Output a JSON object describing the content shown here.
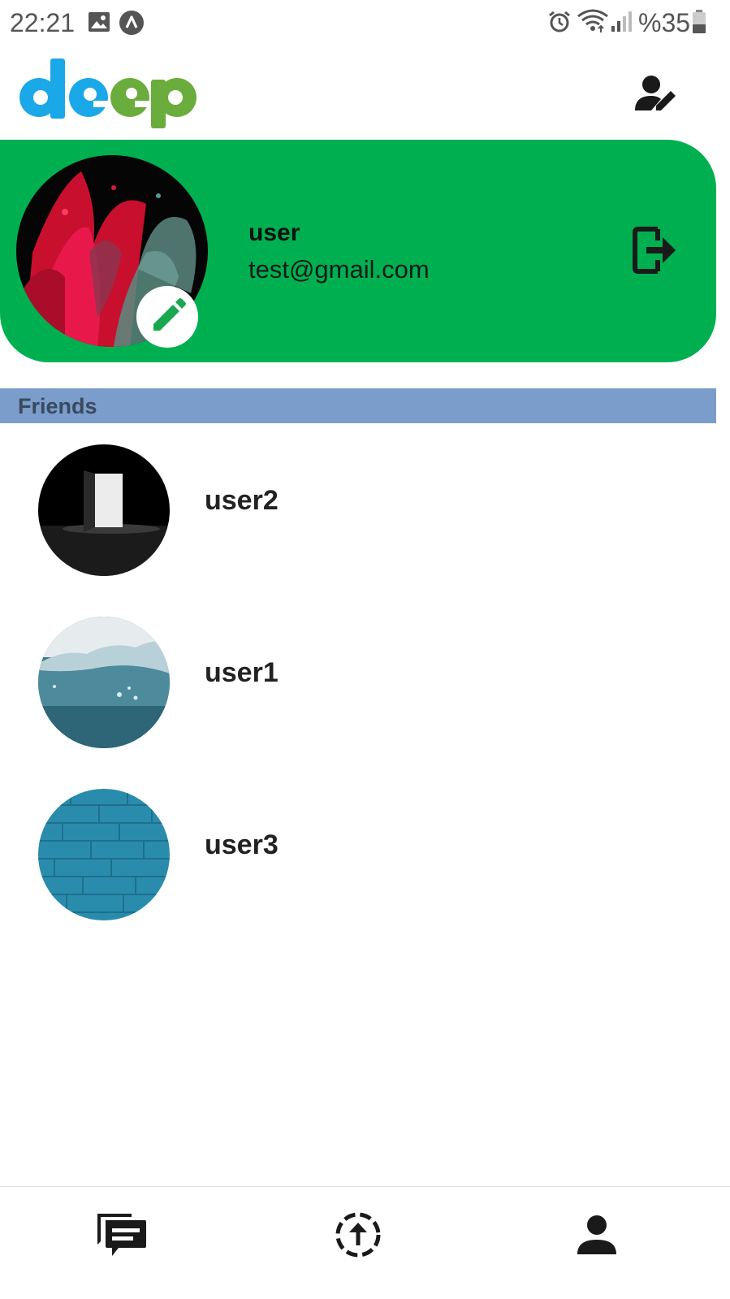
{
  "status_bar": {
    "time": "22:21",
    "battery_text": "%35",
    "icons": [
      "gallery-icon",
      "a-circle-icon",
      "alarm-icon",
      "wifi-icon",
      "signal-icon",
      "battery-icon"
    ]
  },
  "header": {
    "logo": "deep",
    "logo_colors": {
      "de": "#1ba8e8",
      "ep": "#6aad3c"
    },
    "edit_profile_icon": "user-edit-icon"
  },
  "profile": {
    "name": "user",
    "email": "test@gmail.com",
    "card_color": "#00b050",
    "avatar": "color-explosion-photo",
    "edit_avatar_icon": "pencil-icon",
    "logout_icon": "logout-icon"
  },
  "friends": {
    "title": "Friends",
    "header_color": "#7b9dcb",
    "items": [
      {
        "name": "user2",
        "avatar": "door-photo"
      },
      {
        "name": "user1",
        "avatar": "water-photo"
      },
      {
        "name": "user3",
        "avatar": "brick-wall-photo"
      }
    ]
  },
  "bottom_nav": {
    "items": [
      "chat-icon",
      "upload-icon",
      "person-icon"
    ]
  }
}
